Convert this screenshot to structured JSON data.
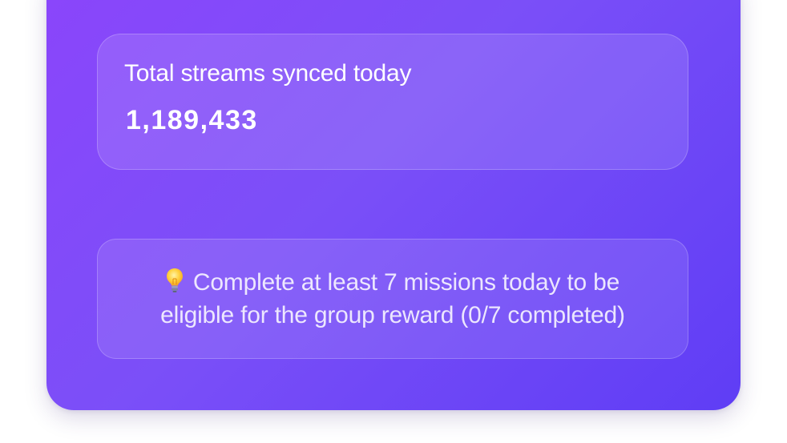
{
  "stats": {
    "label": "Total streams synced today",
    "value": "1,189,433"
  },
  "tip": {
    "icon": "lightbulb-icon",
    "text": "Complete at least 7 missions today to be eligible for the group reward (0/7 completed)"
  },
  "colors": {
    "gradient_start": "#8b45fb",
    "gradient_end": "#5f3df5",
    "text": "#ffffff"
  }
}
